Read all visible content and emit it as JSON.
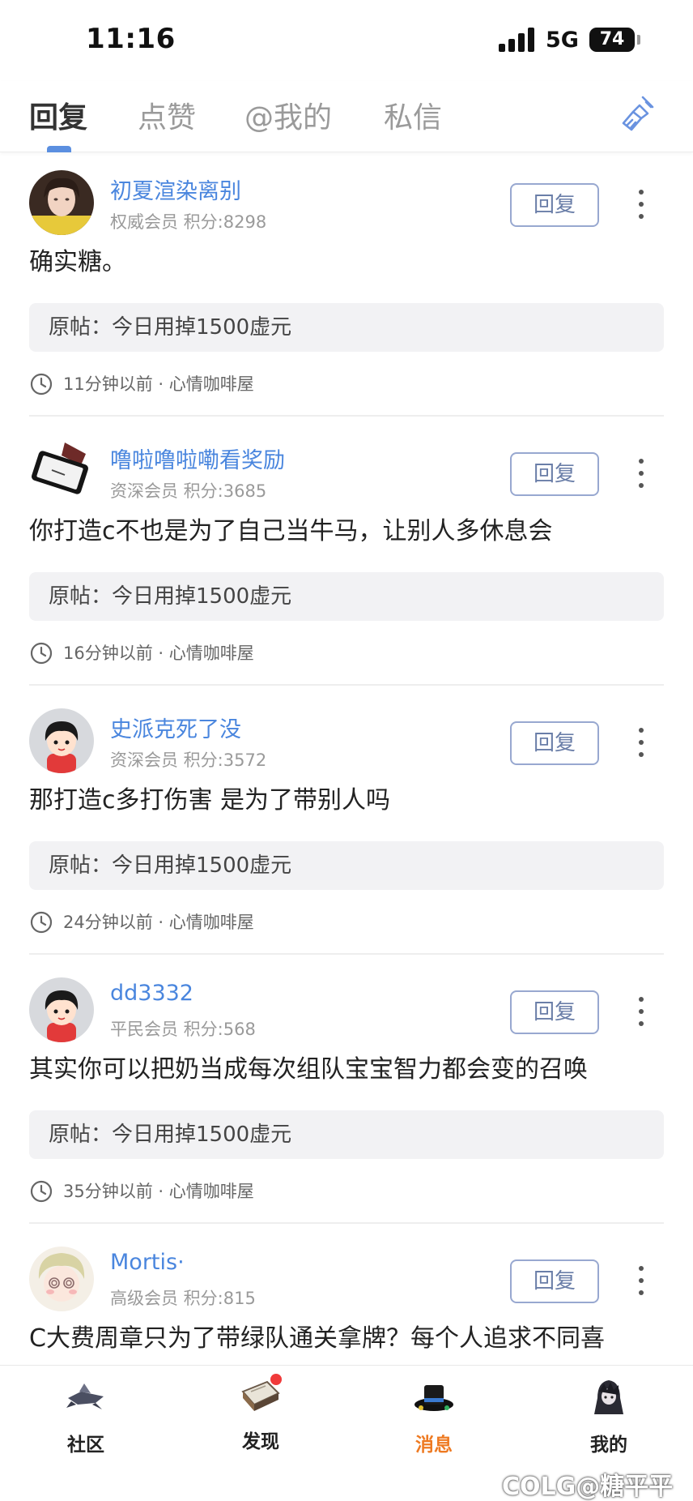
{
  "status_bar": {
    "time": "11:16",
    "network": "5G",
    "battery": "74"
  },
  "tabs": [
    {
      "label": "回复",
      "active": true
    },
    {
      "label": "点赞",
      "active": false
    },
    {
      "label": "@我的",
      "active": false
    },
    {
      "label": "私信",
      "active": false
    }
  ],
  "colors": {
    "link": "#4a86de",
    "accent": "#ee7a22",
    "indicator": "#5b8fe0"
  },
  "replies": [
    {
      "username": "初夏渲染离别",
      "meta": "权威会员 积分:8298",
      "content": "确实糖。",
      "original": "原帖：今日用掉1500虚元",
      "footer": "11分钟以前 · 心情咖啡屋",
      "reply_label": "回复",
      "avatar": "girl-photo-avatar"
    },
    {
      "username": "噜啦噜啦嘞看奖励",
      "meta": "资深会员 积分:3685",
      "content": "你打造c不也是为了自己当牛马，让别人多休息会",
      "original": "原帖：今日用掉1500虚元",
      "footer": "16分钟以前 · 心情咖啡屋",
      "reply_label": "回复",
      "avatar": "phone-hand-avatar"
    },
    {
      "username": "史派克死了没",
      "meta": "资深会员 积分:3572",
      "content": "那打造c多打伤害 是为了带别人吗",
      "original": "原帖：今日用掉1500虚元",
      "footer": "24分钟以前 · 心情咖啡屋",
      "reply_label": "回复",
      "avatar": "default-cartoon-avatar"
    },
    {
      "username": "dd3332",
      "meta": "平民会员 积分:568",
      "content": "其实你可以把奶当成每次组队宝宝智力都会变的召唤",
      "original": "原帖：今日用掉1500虚元",
      "footer": "35分钟以前 · 心情咖啡屋",
      "reply_label": "回复",
      "avatar": "default-cartoon-avatar"
    },
    {
      "username": "Mortis·",
      "meta": "高级会员 积分:815",
      "content": "C大费周章只为了带绿队通关拿牌？每个人追求不同喜",
      "original": "",
      "footer": "",
      "reply_label": "回复",
      "avatar": "anime-spiral-eyes-avatar"
    }
  ],
  "bottom_nav": [
    {
      "label": "社区",
      "icon": "community-icon",
      "active": false,
      "badge": false
    },
    {
      "label": "发现",
      "icon": "discover-icon",
      "active": false,
      "badge": true
    },
    {
      "label": "消息",
      "icon": "message-icon",
      "active": true,
      "badge": false
    },
    {
      "label": "我的",
      "icon": "profile-icon",
      "active": false,
      "badge": false
    }
  ],
  "watermark": "COLG@糖平平"
}
